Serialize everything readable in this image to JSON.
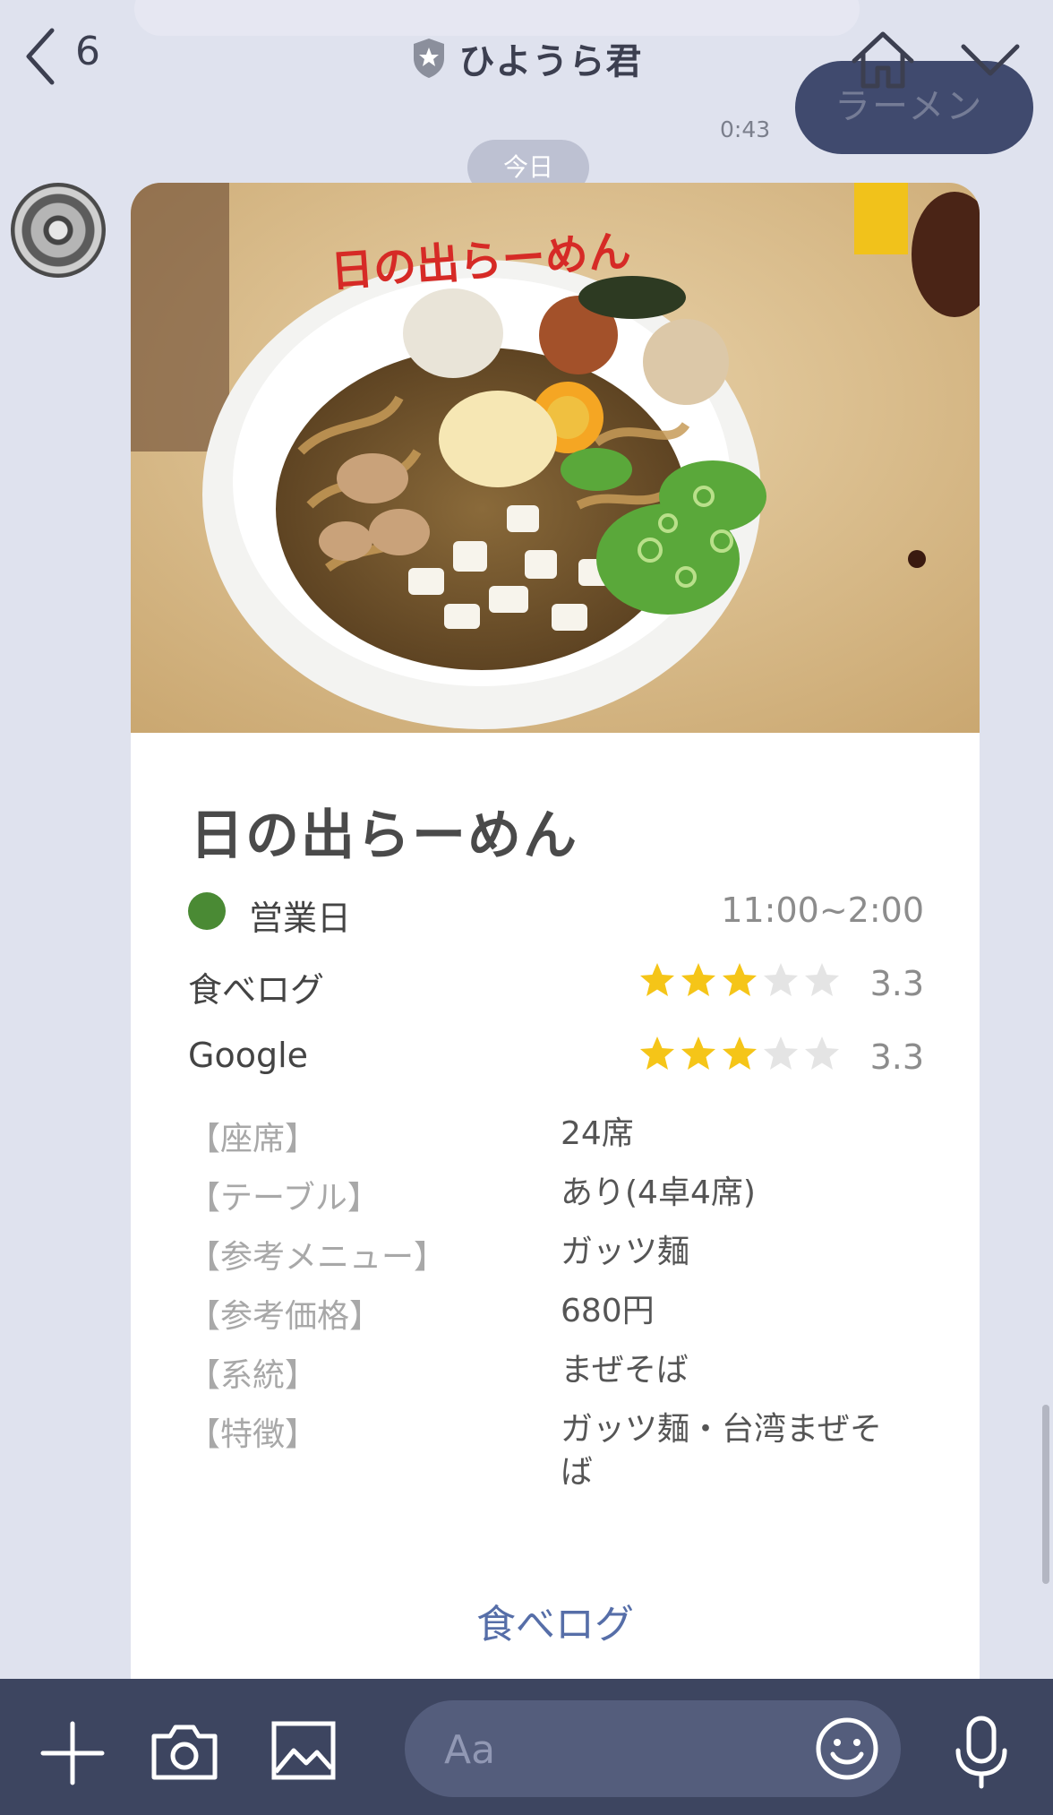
{
  "header": {
    "back_count": "6",
    "title": "ひようら君",
    "icons": {
      "back": "chevron-left-icon",
      "badge": "shield-star-icon",
      "home": "home-icon",
      "menu": "chevron-down-icon"
    }
  },
  "chat": {
    "outgoing_text": "ラーメン",
    "outgoing_time": "0:43",
    "date_separator": "今日",
    "bubble_color": "#404a6e"
  },
  "card": {
    "photo_alt": "日の出らーめん",
    "shop_name": "日の出らーめん",
    "status": {
      "label": "営業日",
      "hours": "11:00~2:00",
      "color": "#4a8a34"
    },
    "ratings": [
      {
        "label": "食べログ",
        "stars": 3,
        "max": 5,
        "value": "3.3"
      },
      {
        "label": "Google",
        "stars": 3,
        "max": 5,
        "value": "3.3"
      }
    ],
    "details": [
      {
        "key": "【座席】",
        "value": "24席"
      },
      {
        "key": "【テーブル】",
        "value": "あり(4卓4席)"
      },
      {
        "key": "【参考メニュー】",
        "value": "ガッツ麺"
      },
      {
        "key": "【参考価格】",
        "value": "680円"
      },
      {
        "key": "【系統】",
        "value": "まぜそば"
      },
      {
        "key": "【特徴】",
        "value": "ガッツ麺・台湾まぜそば"
      }
    ],
    "link_label": "食べログ",
    "star_color": "#f5c518",
    "link_color": "#566ea8"
  },
  "input_bar": {
    "placeholder": "Aa",
    "icons": [
      "plus-icon",
      "camera-icon",
      "image-icon",
      "emoji-icon",
      "mic-icon"
    ],
    "bar_color": "#3d4560"
  }
}
